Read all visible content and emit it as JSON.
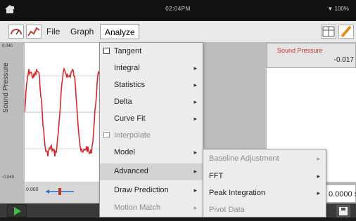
{
  "status_bar": {
    "time": "02:04PM",
    "battery": "100%"
  },
  "menubar": {
    "file": "File",
    "graph": "Graph",
    "analyze": "Analyze"
  },
  "graph": {
    "y_label": "Sound Pressure",
    "y_max": "0.040",
    "y_min": "-0.040",
    "x_start": "0.000"
  },
  "right_panel": {
    "title": "Sound Pressure",
    "value": "-0.017",
    "time_value": "0.0000 s"
  },
  "analyze_menu": {
    "items": [
      {
        "label": "Tangent",
        "type": "checkbox",
        "enabled": true
      },
      {
        "label": "Integral",
        "type": "submenu",
        "enabled": true
      },
      {
        "label": "Statistics",
        "type": "submenu",
        "enabled": true
      },
      {
        "label": "Delta",
        "type": "submenu",
        "enabled": true
      },
      {
        "label": "Curve Fit",
        "type": "submenu",
        "enabled": true
      },
      {
        "label": "Interpolate",
        "type": "checkbox",
        "enabled": false
      },
      {
        "label": "Model",
        "type": "submenu",
        "enabled": true
      },
      {
        "label": "Advanced",
        "type": "submenu",
        "enabled": true,
        "active": true
      },
      {
        "label": "Draw Prediction",
        "type": "submenu",
        "enabled": true
      },
      {
        "label": "Motion Match",
        "type": "submenu",
        "enabled": false
      }
    ]
  },
  "advanced_submenu": {
    "items": [
      {
        "label": "Baseline Adjustment",
        "type": "submenu",
        "enabled": false
      },
      {
        "label": "FFT",
        "type": "submenu",
        "enabled": true
      },
      {
        "label": "Peak Integration",
        "type": "submenu",
        "enabled": true
      },
      {
        "label": "Pivot Data",
        "type": "item",
        "enabled": false
      }
    ]
  },
  "colors": {
    "trace": "#d42a2a",
    "accent_red": "#c9352f",
    "play_green": "#3fbf3f"
  },
  "icons": {
    "home": "home-icon",
    "wifi": "wifi-icon",
    "meter": "meter-icon",
    "graph": "graph-icon",
    "table": "table-icon",
    "pencil": "pencil-icon",
    "play": "play-icon",
    "save": "save-icon",
    "arrow": "chevron-right-icon"
  }
}
